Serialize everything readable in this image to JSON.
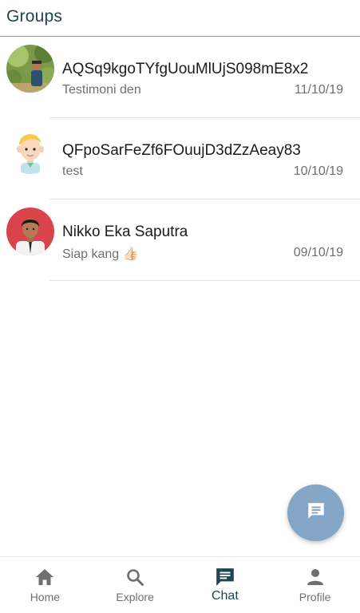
{
  "header": {
    "title": "Groups"
  },
  "groups": [
    {
      "name": "AQSq9kgoTYfgUouMlUjS098mE8x2",
      "preview": "Testimoni den",
      "date": "11/10/19",
      "avatar": "photo-avatar-outdoor"
    },
    {
      "name": "QFpoSarFeZf6FOuujD3dZzAeay83",
      "preview": "test",
      "date": "10/10/19",
      "avatar": "cartoon-avatar"
    },
    {
      "name": "Nikko Eka Saputra",
      "preview": "Siap kang 👍🏻",
      "date": "09/10/19",
      "avatar": "photo-avatar-portrait"
    }
  ],
  "fab": {
    "icon": "chat-bubble-icon",
    "color": "#84a6c6"
  },
  "nav": {
    "items": [
      {
        "label": "Home",
        "icon": "home-icon"
      },
      {
        "label": "Explore",
        "icon": "search-icon"
      },
      {
        "label": "Chat",
        "icon": "chat-icon",
        "active": true
      },
      {
        "label": "Profile",
        "icon": "person-icon"
      }
    ]
  },
  "colors": {
    "accent": "#1f4452",
    "inactive": "#6f6f6f",
    "fab": "#84a6c6"
  }
}
